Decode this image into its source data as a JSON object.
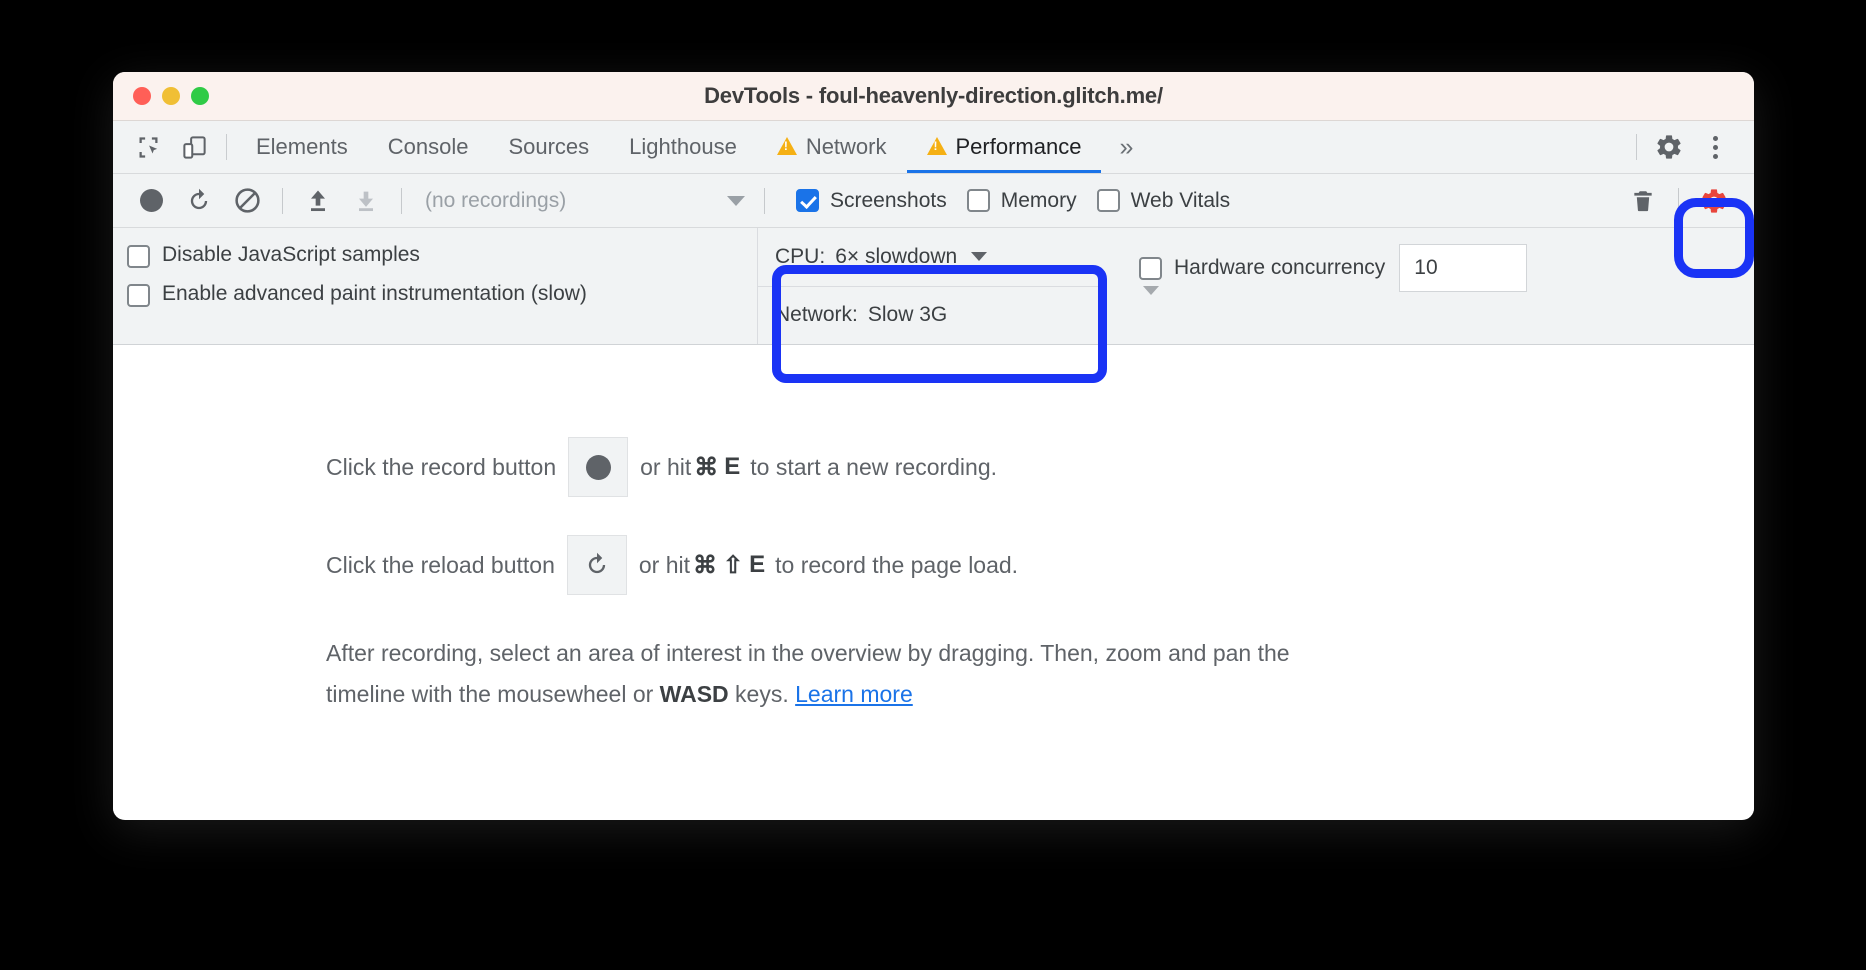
{
  "window": {
    "title": "DevTools - foul-heavenly-direction.glitch.me/",
    "traffic_lights": [
      "close",
      "minimize",
      "maximize"
    ]
  },
  "tabbar": {
    "left_icons": [
      {
        "name": "inspect-element-icon",
        "label": "Inspect element"
      },
      {
        "name": "device-toolbar-icon",
        "label": "Toggle device toolbar"
      }
    ],
    "tabs": [
      {
        "label": "Elements",
        "active": false,
        "warning": false
      },
      {
        "label": "Console",
        "active": false,
        "warning": false
      },
      {
        "label": "Sources",
        "active": false,
        "warning": false
      },
      {
        "label": "Lighthouse",
        "active": false,
        "warning": false
      },
      {
        "label": "Network",
        "active": false,
        "warning": true
      },
      {
        "label": "Performance",
        "active": true,
        "warning": true
      }
    ],
    "overflow_label": "»",
    "right_icons": [
      {
        "name": "settings-gear-icon",
        "label": "Settings"
      },
      {
        "name": "more-options-kebab-icon",
        "label": "Customize and control DevTools"
      }
    ]
  },
  "toolbar": {
    "record_label": "Record",
    "reload_record_label": "Start profiling and reload page",
    "clear_label": "Clear",
    "load_profile_label": "Load profile",
    "save_profile_label": "Save profile",
    "recordings_value": "(no recordings)",
    "checkboxes": [
      {
        "label": "Screenshots",
        "checked": true
      },
      {
        "label": "Memory",
        "checked": false
      },
      {
        "label": "Web Vitals",
        "checked": false
      }
    ],
    "trash_label": "Collect garbage",
    "capture_settings_label": "Capture settings"
  },
  "capture_settings": {
    "options": [
      {
        "label": "Disable JavaScript samples",
        "checked": false
      },
      {
        "label": "Enable advanced paint instrumentation (slow)",
        "checked": false
      }
    ],
    "cpu": {
      "key": "CPU:",
      "value": "6× slowdown"
    },
    "network": {
      "key": "Network:",
      "value": "Slow 3G"
    },
    "hardware_concurrency": {
      "label": "Hardware concurrency",
      "checked": false,
      "value": "10"
    }
  },
  "content": {
    "line1_prefix": "Click the record button",
    "line1_suffix_a": "or hit",
    "line1_key1": "⌘",
    "line1_key2": "E",
    "line1_suffix_b": "to start a new recording.",
    "line2_prefix": "Click the reload button",
    "line2_suffix_a": "or hit",
    "line2_key1": "⌘",
    "line2_key2": "⇧",
    "line2_key3": "E",
    "line2_suffix_b": "to record the page load.",
    "para_a": "After recording, select an area of interest in the overview by dragging. Then, zoom and pan the timeline with the mousewheel or ",
    "para_bold": "WASD",
    "para_b": " keys. ",
    "para_link": "Learn more"
  },
  "annotations": {
    "highlight_color": "#1a33f5",
    "targets": [
      "capture-settings-gear",
      "cpu-and-network-throttling"
    ]
  },
  "colors": {
    "accent_blue": "#1a73e8",
    "annotation_blue": "#1a33f5",
    "active_gear_red": "#e8453c",
    "warning_yellow": "#f5b014",
    "toolbar_bg": "#f1f3f4",
    "titlebar_bg": "#fbf2ee",
    "page_bg": "#000000"
  }
}
